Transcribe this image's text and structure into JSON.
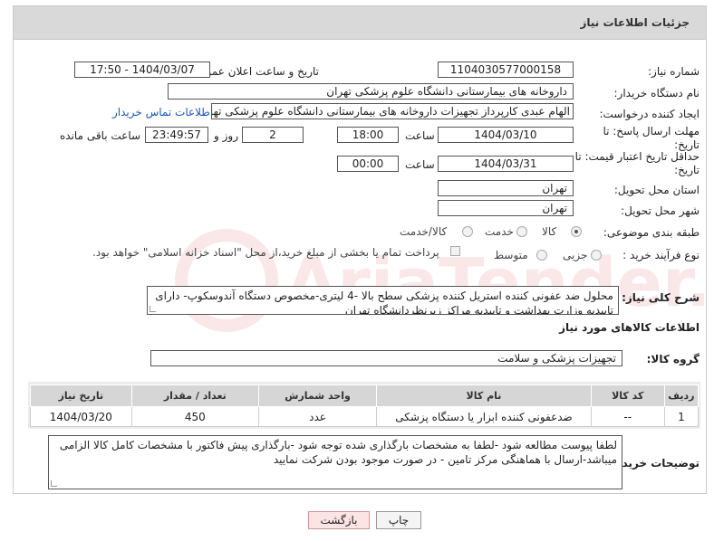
{
  "header": {
    "title": "جزئیات اطلاعات نیاز"
  },
  "fields": {
    "need_number_label": "شماره نیاز:",
    "need_number": "1104030577000158",
    "announce_label": "تاریخ و ساعت اعلان عمومی:",
    "announce_value": "1404/03/07 - 17:50",
    "buyer_org_label": "نام دستگاه خریدار:",
    "buyer_org": "داروخانه های بیمارستانی دانشگاه علوم پزشکی تهران",
    "requester_label": "ایجاد کننده درخواست:",
    "requester": "الهام عبدی کارپرداز تجهیزات داروخانه های بیمارستانی دانشگاه علوم پزشکی تهران",
    "contact_link": "اطلاعات تماس خریدار",
    "reply_deadline_label": "مهلت ارسال پاسخ: تا تاریخ:",
    "reply_date": "1404/03/10",
    "time_label": "ساعت",
    "reply_time": "18:00",
    "days_value": "2",
    "days_label": "روز و",
    "remaining_time": "23:49:57",
    "remaining_label": "ساعت باقی مانده",
    "price_validity_label": "حداقل تاریخ اعتبار قیمت: تا تاریخ:",
    "price_date": "1404/03/31",
    "price_time": "00:00",
    "province_label": "استان محل تحویل:",
    "province": "تهران",
    "city_label": "شهر محل تحویل:",
    "city": "تهران",
    "category_label": "طبقه بندی موضوعی:",
    "category_options": [
      "کالا",
      "خدمت",
      "کالا/خدمت"
    ],
    "process_label": "نوع فرآیند خرید :",
    "process_options": [
      "جزیی",
      "متوسط"
    ],
    "payment_note": "پرداخت تمام یا بخشی از مبلغ خرید،از محل \"اسناد خزانه اسلامی\" خواهد بود.",
    "summary_label": "شرح کلی نیاز:",
    "summary": "محلول ضد عفونی کننده استریل کننده پزشکی سطح بالا -4 لیتری-مخصوص دستگاه آندوسکوپ- دارای تاییدیه وزارت بهداشت و تاییدیه مراکز زیرنظردانشگاه تهران",
    "goods_info_title": "اطلاعات کالاهای مورد نیاز",
    "goods_group_label": "گروه کالا:",
    "goods_group": "تجهیزات پزشکی و سلامت",
    "buyer_notes_label": "توضیحات خریدار:",
    "buyer_notes": "لطفا پیوست مطالعه شود -لطفا به مشخصات بارگذاری شده توجه شود -بارگذاری پیش فاکتور با مشخصات کامل کالا الزامی میباشد-ارسال با هماهنگی مرکز تامین - در صورت موجود بودن شرکت نمایید"
  },
  "table": {
    "headers": [
      "ردیف",
      "کد کالا",
      "نام کالا",
      "واحد شمارش",
      "تعداد / مقدار",
      "تاریخ نیاز"
    ],
    "rows": [
      [
        "1",
        "--",
        "ضدعفونی کننده ابزار یا دستگاه پزشکی",
        "عدد",
        "450",
        "1404/03/20"
      ]
    ]
  },
  "buttons": {
    "print": "چاپ",
    "back": "بازگشت"
  },
  "watermark_text": "AriaTender.neT"
}
